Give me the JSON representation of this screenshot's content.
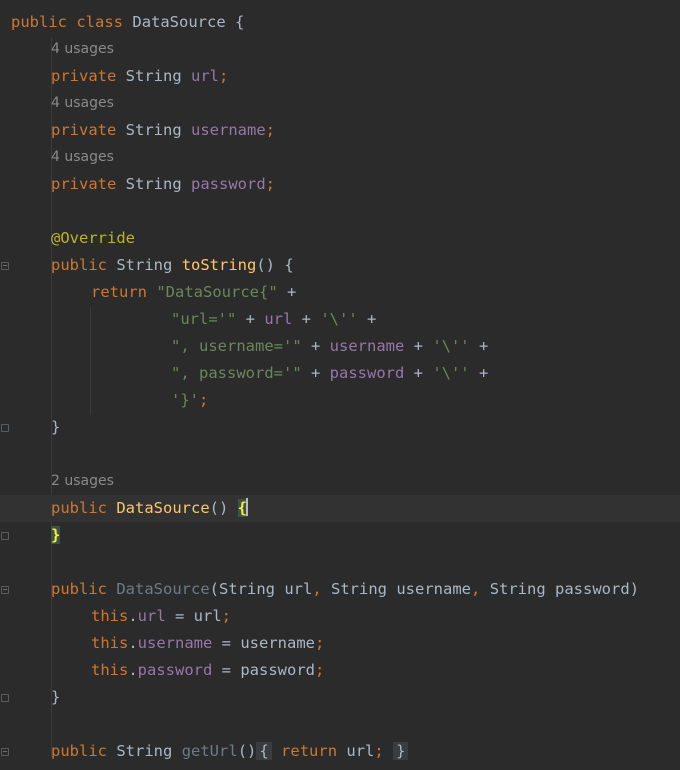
{
  "editor": {
    "lines": {
      "l1": {
        "kw1": "public",
        "kw2": "class",
        "name": "DataSource",
        "brace": "{"
      },
      "u1": "4 usages",
      "l2": {
        "kw1": "private",
        "type": "String",
        "field": "url",
        "semi": ";"
      },
      "u2": "4 usages",
      "l3": {
        "kw1": "private",
        "type": "String",
        "field": "username",
        "semi": ";"
      },
      "u3": "4 usages",
      "l4": {
        "kw1": "private",
        "type": "String",
        "field": "password",
        "semi": ";"
      },
      "l5": {
        "annotation": "@Override"
      },
      "l6": {
        "kw1": "public",
        "type": "String",
        "method": "toString",
        "rest": "() {"
      },
      "l7": {
        "kw": "return",
        "str": "\"DataSource{\"",
        "plus": " +"
      },
      "l8": {
        "str1": "\"url='\"",
        "op1": " + ",
        "field": "url",
        "op2": " + ",
        "str2": "'\\''",
        "op3": " +"
      },
      "l9": {
        "str1": "\", username='\"",
        "op1": " + ",
        "field": "username",
        "op2": " + ",
        "str2": "'\\''",
        "op3": " +"
      },
      "l10": {
        "str1": "\", password='\"",
        "op1": " + ",
        "field": "password",
        "op2": " + ",
        "str2": "'\\''",
        "op3": " +"
      },
      "l11": {
        "str1": "'}'",
        "semi": ";"
      },
      "l12": {
        "brace": "}"
      },
      "u4": "2 usages",
      "l13": {
        "kw1": "public",
        "method": "DataSource",
        "paren": "() ",
        "brace": "{"
      },
      "l14": {
        "brace": "}"
      },
      "l15": {
        "kw1": "public",
        "ctor": "DataSource",
        "open": "(",
        "t1": "String",
        "p1": " url",
        "c1": ", ",
        "t2": "String",
        "p2": " username",
        "c2": ", ",
        "t3": "String",
        "p3": " password",
        "close": ")"
      },
      "l16": {
        "kw": "this",
        "dot": ".",
        "field": "url",
        "rest": " = url",
        "semi": ";"
      },
      "l17": {
        "kw": "this",
        "dot": ".",
        "field": "username",
        "rest": " = username",
        "semi": ";"
      },
      "l18": {
        "kw": "this",
        "dot": ".",
        "field": "password",
        "rest": " = password",
        "semi": ";"
      },
      "l19": {
        "brace": "}"
      },
      "l20": {
        "kw1": "public",
        "type": "String",
        "method": "getUrl",
        "paren": "()",
        "fold_open": "{",
        "kw2": "return",
        "field": " url",
        "semi": ";",
        "fold_close": "}"
      }
    }
  }
}
